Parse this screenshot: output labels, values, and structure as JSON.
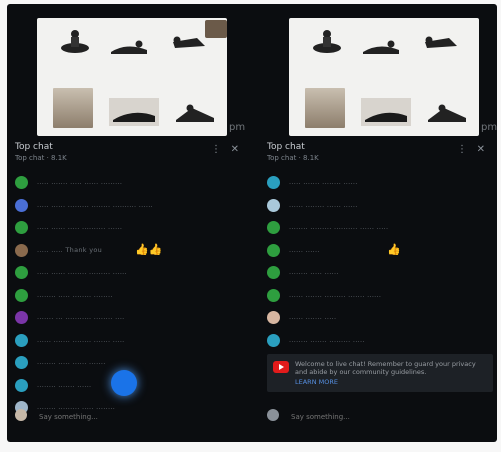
{
  "left": {
    "chat": {
      "title": "Top chat",
      "subtitle": "Top chat · 8.1K"
    },
    "messages": [
      {
        "color": "#2e9e3f",
        "text": "..... ....... ..... ...... ........."
      },
      {
        "color": "#4a6fd6",
        "text": "..... ...... ......... ........ .......... ......"
      },
      {
        "color": "#2e9e3f",
        "text": "..... ...... ..... .......... ......"
      },
      {
        "color": "#8a6a4d",
        "text": "..... ..... Thank you ",
        "emoji": "👍👍"
      },
      {
        "color": "#2e9e3f",
        "text": "..... ...... ........ ......... ......"
      },
      {
        "color": "#2e9e3f",
        "text": "........ ..... ........ ........"
      },
      {
        "color": "#7a35a8",
        "text": "....... ... ........... ........ ...."
      },
      {
        "color": "#2a9fbf",
        "text": "...... ....... ........ ....... ....."
      },
      {
        "color": "#2a9fbf",
        "text": "........ ..... ...... ......."
      },
      {
        "color": "#2a9fbf",
        "text": "........ ....... ......"
      },
      {
        "color": "#9fb6c9",
        "text": "........ ......... ..... ........"
      }
    ],
    "input_placeholder": "Say something..."
  },
  "right": {
    "chat": {
      "title": "Top chat",
      "subtitle": "Top chat · 8.1K"
    },
    "messages": [
      {
        "color": "#2a9fbf",
        "text": "..... ....... ........ ......"
      },
      {
        "color": "#a9c8da",
        "text": "...... ........ ...... ......"
      },
      {
        "color": "#2e9e3f",
        "text": "........ ......... .......... ...... ....."
      },
      {
        "color": "#2e9e3f",
        "text": "...... ...... ",
        "emoji": "👍"
      },
      {
        "color": "#2e9e3f",
        "text": "........ ..... ......"
      },
      {
        "color": "#2e9e3f",
        "text": "...... ....... ......... ....... ......"
      },
      {
        "color": "#d7b6a1",
        "text": "...... ....... ....."
      },
      {
        "color": "#2a9fbf",
        "text": "........ ....... ......... ....."
      },
      {
        "color": "#d32f2f",
        "text": "........ ....... ........ ......."
      }
    ],
    "promo_text": "Welcome to live chat! Remember to guard your privacy and abide by our community guidelines.",
    "promo_link": "LEARN MORE",
    "input_placeholder": "Say something..."
  }
}
